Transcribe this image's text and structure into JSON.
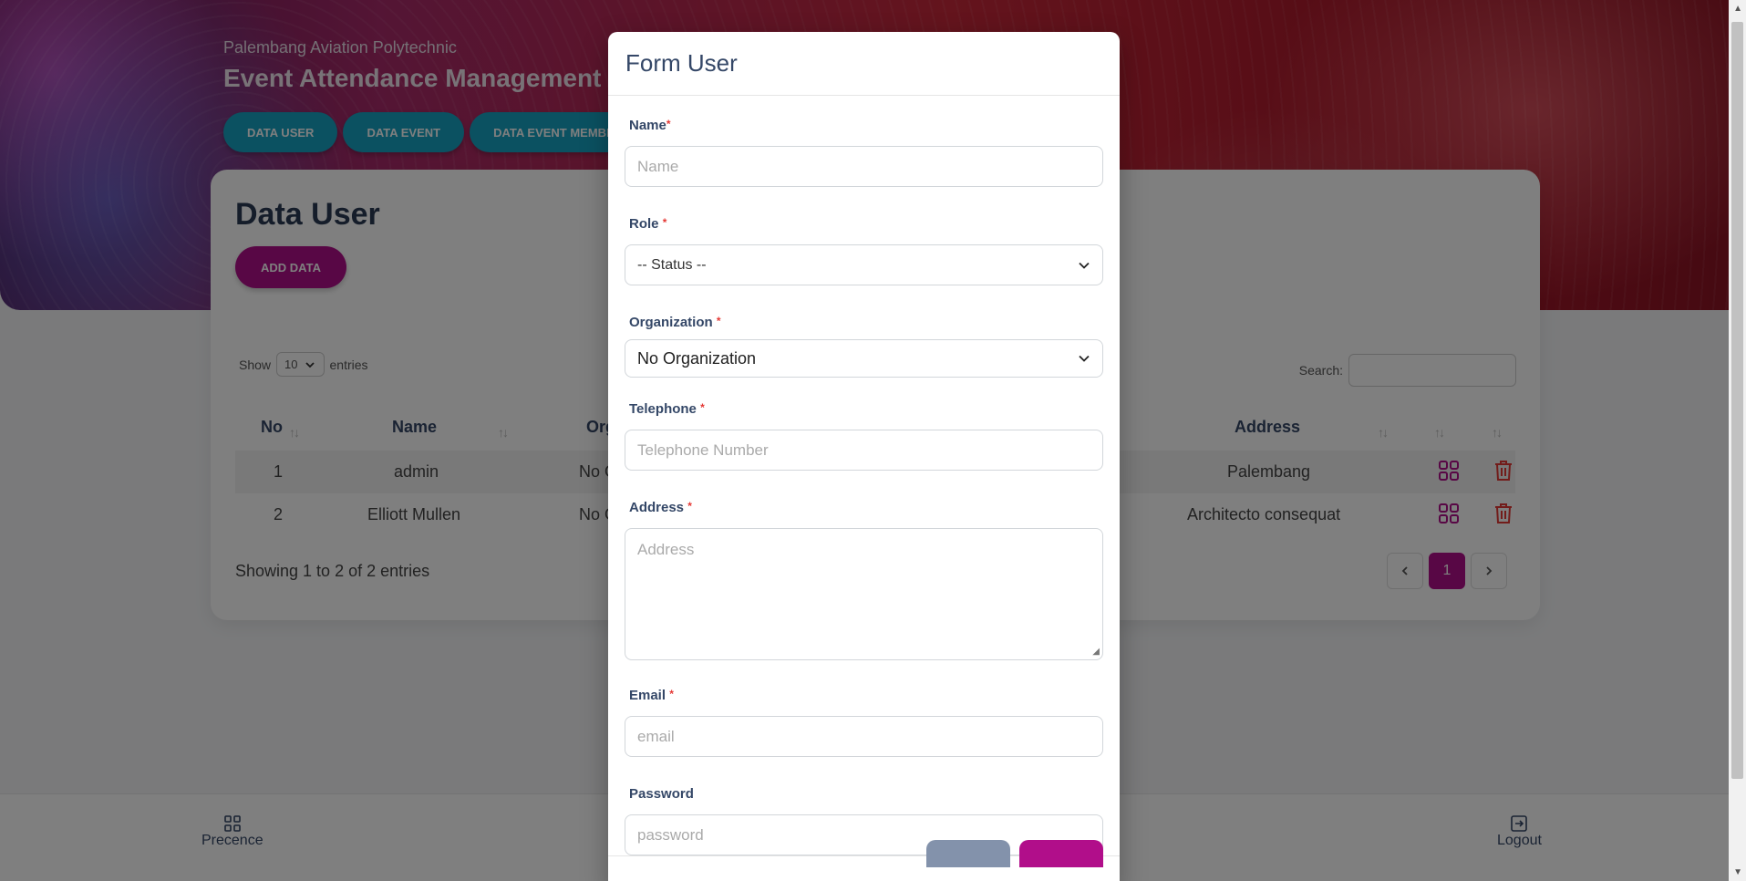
{
  "header": {
    "school": "Palembang Aviation Polytechnic",
    "app_title": "Event Attendance Management Application",
    "nav": [
      "DATA USER",
      "DATA EVENT",
      "DATA EVENT MEMBER"
    ]
  },
  "card": {
    "title": "Data User",
    "add_button": "ADD DATA",
    "show_label": "Show",
    "entries_value": "10",
    "entries_label": "entries",
    "search_label": "Search:",
    "search_value": ""
  },
  "table": {
    "columns": [
      "No",
      "Name",
      "Organization",
      "Address"
    ],
    "rows": [
      {
        "no": "1",
        "name": "admin",
        "org": "No Organization",
        "address": "Palembang"
      },
      {
        "no": "2",
        "name": "Elliott Mullen",
        "org": "No Organization",
        "address": "Architecto consequat"
      }
    ],
    "showing": "Showing 1 to 2 of 2 entries",
    "current_page": "1"
  },
  "footer": {
    "left_label": "Precence",
    "right_label": "Logout"
  },
  "modal": {
    "title": "Form User",
    "fields": {
      "name": {
        "label": "Name",
        "placeholder": "Name"
      },
      "role": {
        "label": "Role",
        "value": "-- Status --"
      },
      "organization": {
        "label": "Organization",
        "value": "No Organization"
      },
      "telephone": {
        "label": "Telephone",
        "placeholder": "Telephone Number"
      },
      "address": {
        "label": "Address",
        "placeholder": "Address"
      },
      "email": {
        "label": "Email",
        "placeholder": "email"
      },
      "password": {
        "label": "Password",
        "placeholder": "password"
      }
    },
    "required_mark": "*"
  },
  "colors": {
    "primary": "#b10e8a",
    "nav_pill": "#17a2c3",
    "danger": "#e53935"
  }
}
